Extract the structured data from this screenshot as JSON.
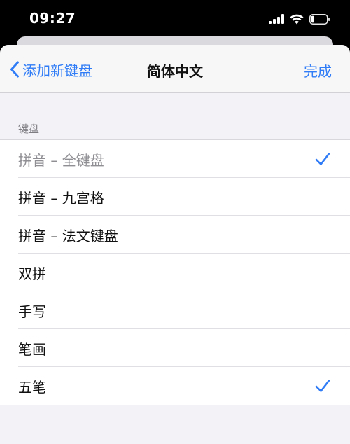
{
  "status_bar": {
    "time": "09:27",
    "icons": [
      "cellular-signal-icon",
      "wifi-icon",
      "battery-icon"
    ],
    "battery_level": 0.2
  },
  "nav": {
    "back_label": "添加新键盘",
    "title": "简体中文",
    "done_label": "完成"
  },
  "section": {
    "header": "键盘"
  },
  "keyboards": [
    {
      "label": "拼音 – 全键盘",
      "checked": true,
      "disabled": true
    },
    {
      "label": "拼音 – 九宫格",
      "checked": false,
      "disabled": false
    },
    {
      "label": "拼音 – 法文键盘",
      "checked": false,
      "disabled": false
    },
    {
      "label": "双拼",
      "checked": false,
      "disabled": false
    },
    {
      "label": "手写",
      "checked": false,
      "disabled": false
    },
    {
      "label": "笔画",
      "checked": false,
      "disabled": false
    },
    {
      "label": "五笔",
      "checked": true,
      "disabled": false
    }
  ],
  "colors": {
    "accent": "#2f7cf6",
    "sheet_background": "#f2f2f7",
    "disabled_text": "#8e8e93"
  }
}
